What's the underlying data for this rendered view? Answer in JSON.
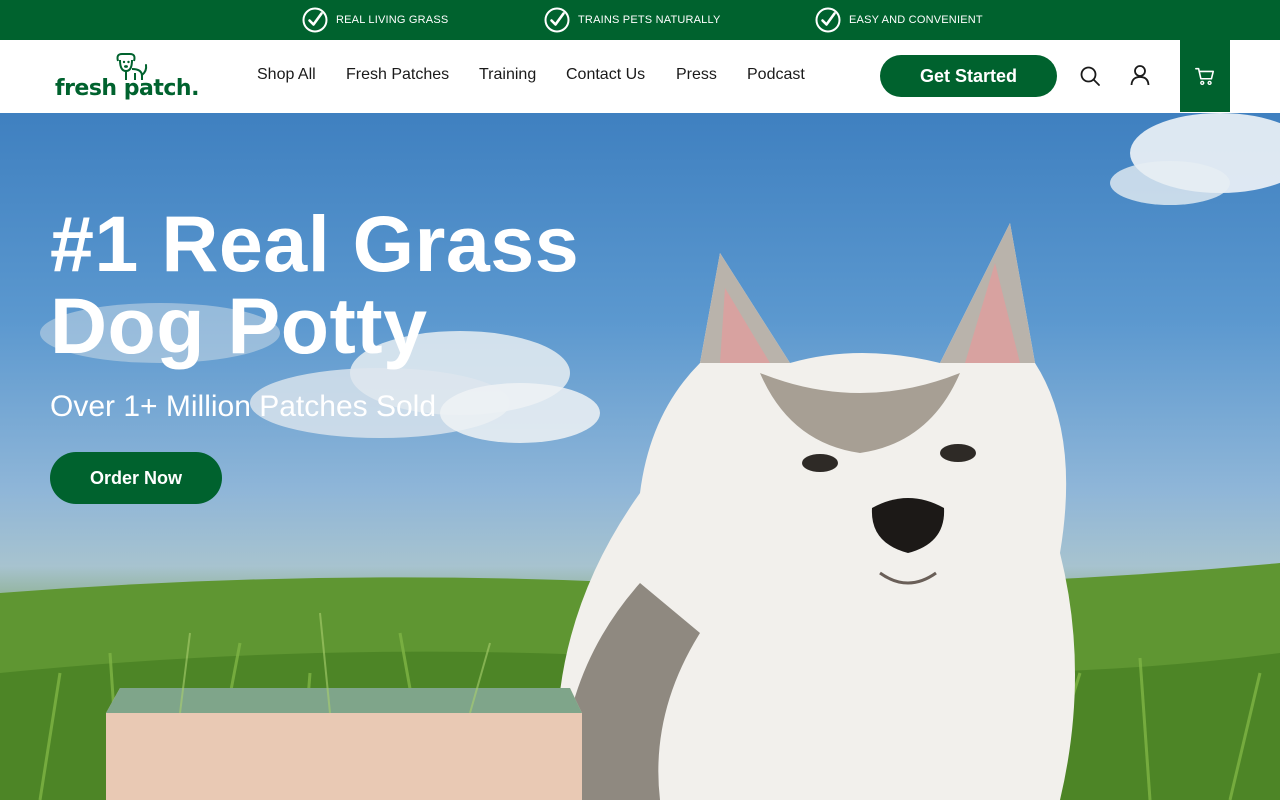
{
  "announcement": {
    "items": [
      {
        "label": "REAL LIVING GRASS",
        "icon": "check-circle-icon"
      },
      {
        "label": "TRAINS PETS NATURALLY",
        "icon": "check-circle-icon"
      },
      {
        "label": "EASY AND CONVENIENT",
        "icon": "check-circle-icon"
      }
    ]
  },
  "header": {
    "logo_text": "fresh patch.",
    "logo_icon": "dog-icon",
    "nav": [
      {
        "label": "Shop All"
      },
      {
        "label": "Fresh Patches"
      },
      {
        "label": "Training"
      },
      {
        "label": "Contact Us"
      },
      {
        "label": "Press"
      },
      {
        "label": "Podcast"
      }
    ],
    "cta_label": "Get Started",
    "icons": [
      "search-icon",
      "account-icon",
      "cart-icon"
    ]
  },
  "hero": {
    "title": "#1 Real Grass Dog Potty",
    "subtitle": "Over 1+ Million Patches Sold",
    "button_label": "Order Now"
  },
  "colors": {
    "brand_green": "#00622e",
    "text_dark": "#1a1a1a",
    "white": "#ffffff"
  }
}
